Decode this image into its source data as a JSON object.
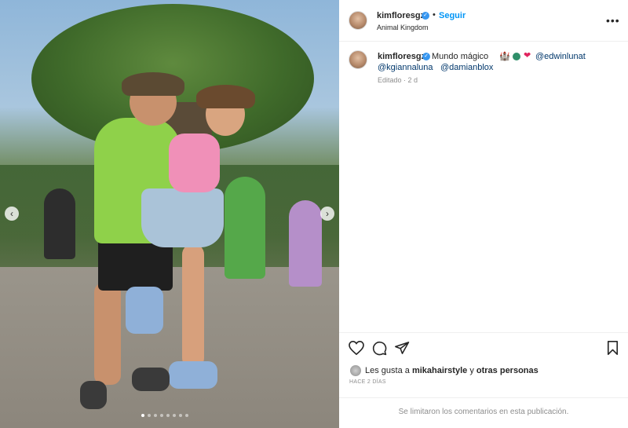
{
  "post": {
    "username": "kimfloresgz",
    "follow_label": "Seguir",
    "location": "Animal Kingdom",
    "more_label": "•••",
    "bullet": "•"
  },
  "caption": {
    "text": "Mundo mágico",
    "emoji_castle": "🏰",
    "emoji_heart": "❤",
    "mention_1": "@edwinlunat",
    "mention_2": "@kgiannaluna",
    "mention_3": "@damianblox",
    "edited": "Editado · 2 d"
  },
  "likes": {
    "prefix": "Les gusta a ",
    "user": "mikahairstyle",
    "middle": " y ",
    "others": "otras personas"
  },
  "time_ago": "HACE 2 DÍAS",
  "comments_disabled": "Se limitaron los comentarios en esta publicación.",
  "carousel": {
    "count": 8,
    "active_index": 0
  },
  "colors": {
    "accent": "#0095f6",
    "verified": "#3897f0",
    "mention": "#00376b",
    "heart": "#e0245e"
  },
  "icons": [
    "heart-icon",
    "comment-icon",
    "share-icon",
    "bookmark-icon",
    "chevron-left-icon",
    "chevron-right-icon",
    "verified-badge-icon"
  ]
}
